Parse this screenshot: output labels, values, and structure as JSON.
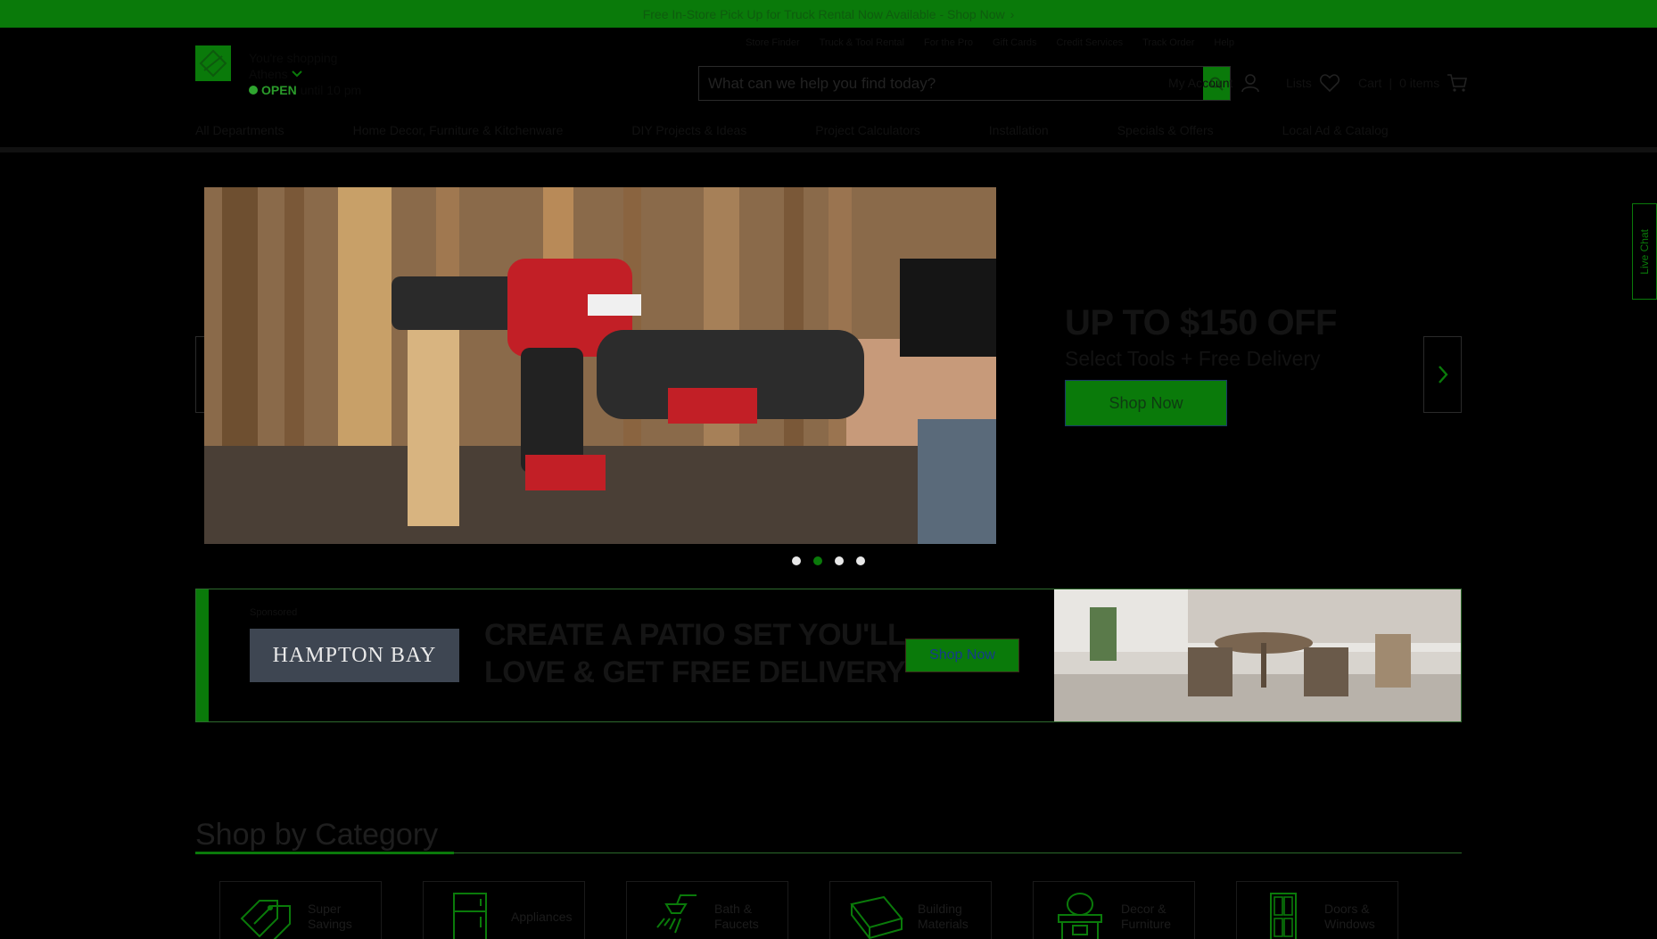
{
  "promo": {
    "text": "Free In-Store Pick Up for Truck Rental Now Available - Shop Now",
    "chevron": "›"
  },
  "header": {
    "logo_alt": "THE HOME DEPOT",
    "store": {
      "label": "You're shopping",
      "name": "Athens",
      "open_label": "OPEN",
      "hours": "until 10 pm"
    },
    "util_links": [
      "Store Finder",
      "Truck & Tool Rental",
      "For the Pro",
      "Gift Cards",
      "Credit Services",
      "Track Order",
      "Help"
    ],
    "search": {
      "placeholder": "What can we help you find today?",
      "value": ""
    },
    "account_label": "My Account",
    "lists_label": "Lists",
    "cart_label": "Cart",
    "cart_count": "0 items",
    "nav": [
      "All Departments",
      "Home Decor, Furniture & Kitchenware",
      "DIY Projects & Ideas",
      "Project Calculators",
      "Installation",
      "Specials & Offers",
      "Local Ad & Catalog"
    ]
  },
  "hero": {
    "headline": "UP TO $150 OFF",
    "subheading": "Select Tools + Free Delivery",
    "cta": "Shop Now",
    "slide_count": 4,
    "active_slide": 2
  },
  "sponsored": {
    "label": "Sponsored",
    "brand": "HAMPTON BAY",
    "headline_line1": "CREATE A PATIO SET YOU'LL",
    "headline_line2": "LOVE & GET FREE DELIVERY",
    "cta": "Shop Now"
  },
  "categories": {
    "title": "Shop by Category",
    "items": [
      {
        "label": "Super Savings",
        "icon": "tags-icon"
      },
      {
        "label": "Appliances",
        "icon": "refrigerator-icon"
      },
      {
        "label": "Bath & Faucets",
        "icon": "shower-icon"
      },
      {
        "label": "Building Materials",
        "icon": "lumber-icon"
      },
      {
        "label": "Decor & Furniture",
        "icon": "vanity-icon"
      },
      {
        "label": "Doors & Windows",
        "icon": "door-icon"
      }
    ]
  },
  "live_chat": {
    "label": "Live Chat"
  },
  "colors": {
    "brand_green": "#0a7a0a",
    "background": "#000000"
  }
}
